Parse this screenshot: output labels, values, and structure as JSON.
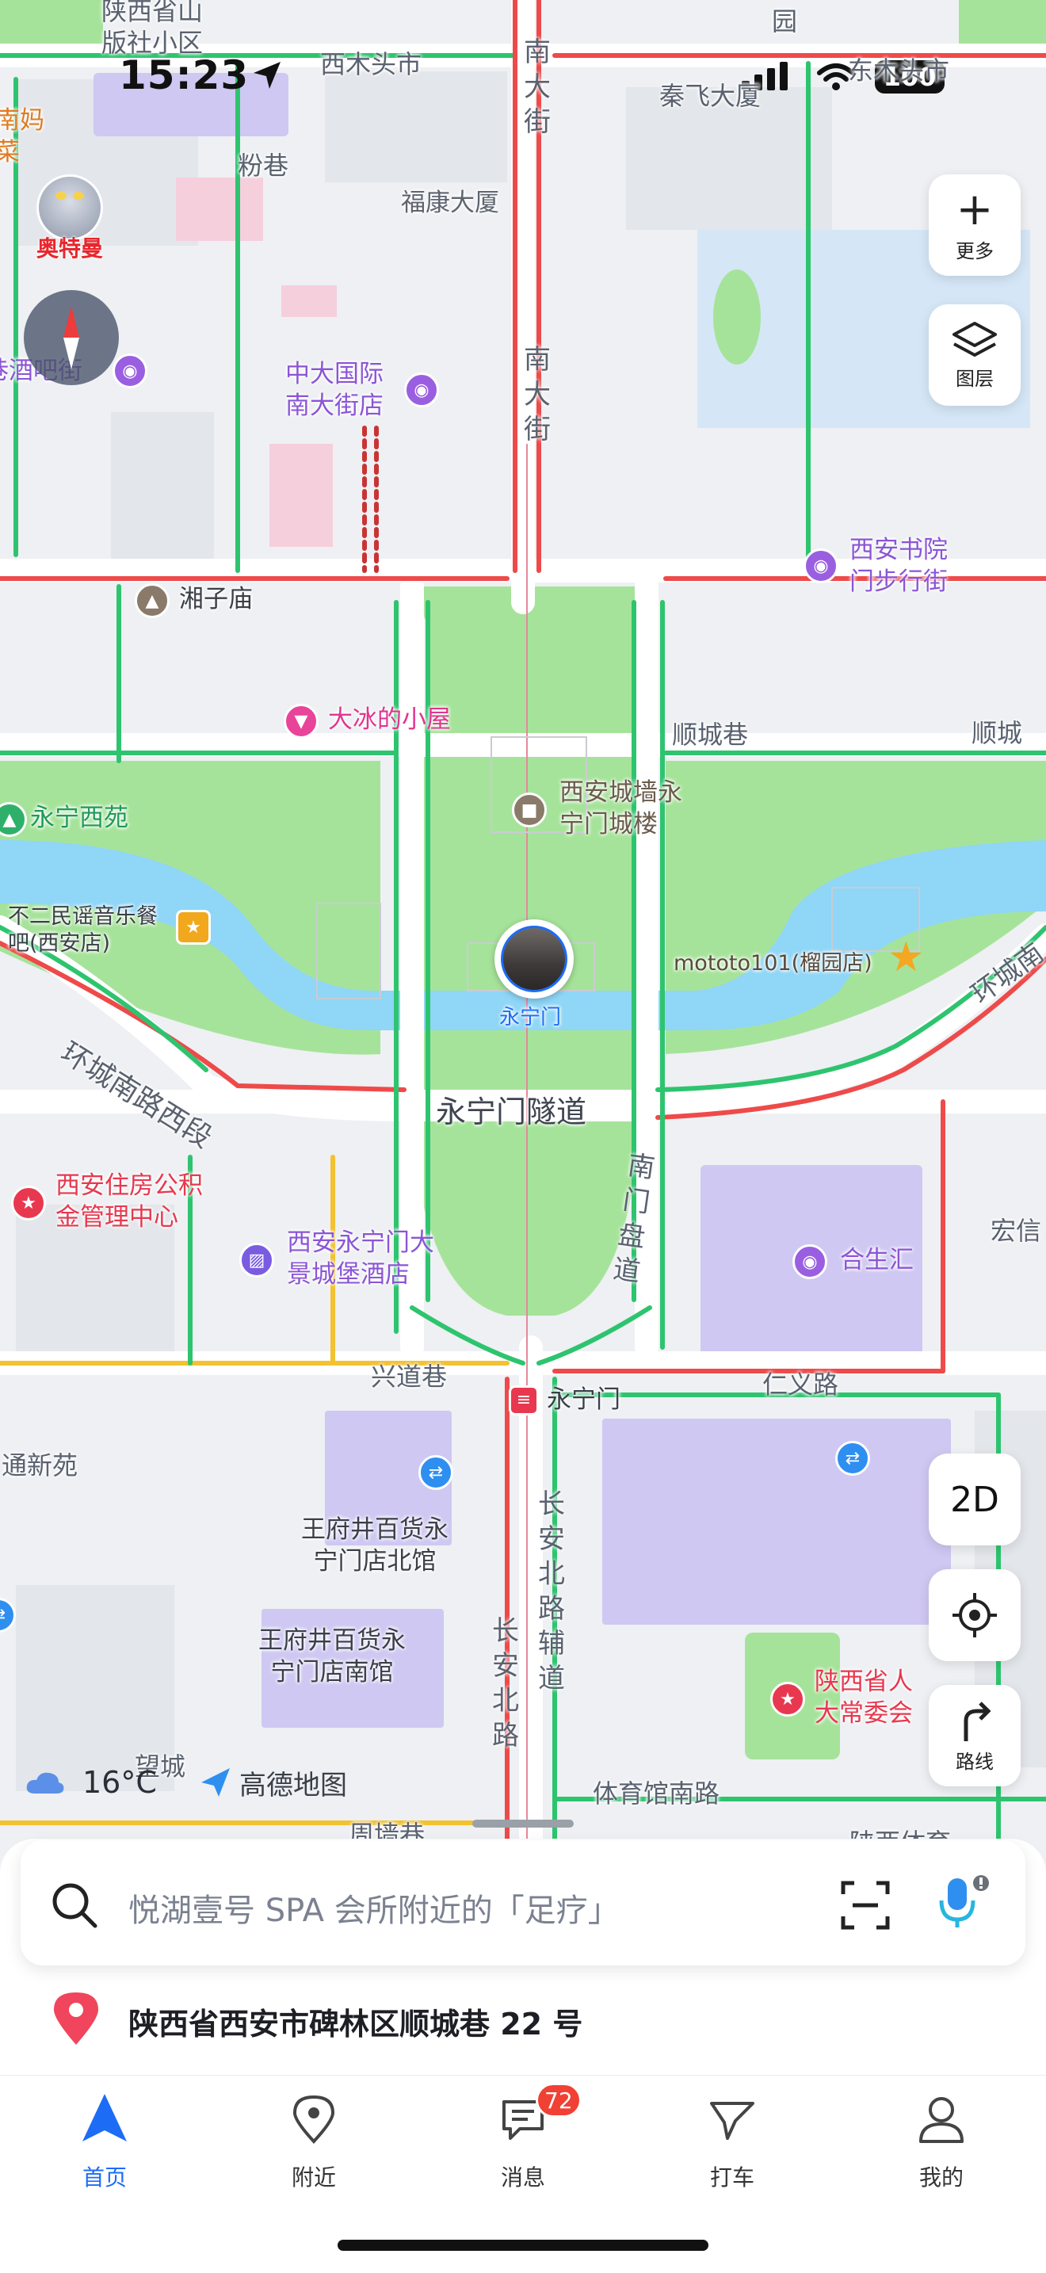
{
  "status_bar": {
    "time": "15:23",
    "battery": "100"
  },
  "map": {
    "road_labels": {
      "xi_mu_tou_shi": "西木头市",
      "fen_xiang": "粉巷",
      "nan_da_jie_1": "南大街",
      "nan_da_jie_2": "南大街",
      "qin_fei_da_xia": "秦飞大厦",
      "dong_mu_tou_shi": "东木头市",
      "shun_cheng_xiang": "顺城巷",
      "shun_cheng_right": "顺城",
      "huan_cheng_nan_lu_xi_duan": "环城南路西段",
      "yong_ning_men_sui_dao": "永宁门隧道",
      "nan_men_pan_dao": "南门盘道",
      "huan_cheng_right": "环城南",
      "xing_dao_xiang": "兴道巷",
      "ren_yi_lu": "仁义路",
      "chang_an_bei_lu_fu_dao": "长安北路辅道",
      "chang_an_bei_lu": "长安北路",
      "ti_yu_guan_nan_lu": "体育馆南路",
      "tong_xin_yuan": "通新苑",
      "wang_cheng": "望城",
      "zhou_qiang_xiang": "周墙巷",
      "hong_xin": "宏信",
      "top_left_partial": "陕西省山\n版社小区",
      "top_right_partial": "园",
      "left_partial": "南妈\n菜",
      "shaanxi_ti_yu": "陕西体育"
    },
    "pois": {
      "fu_kang_da_xia": "福康大厦",
      "zhong_da_guo_ji": "中大国际\n南大街店",
      "xiang_zi_miao": "湘子庙",
      "xi_an_shu_yuan": "西安书院\n门步行街",
      "da_bing_de_xiao_wu": "大冰的小屋",
      "xi_an_cheng_qiang": "西安城墙永\n宁门城楼",
      "yong_ning_xi_yuan": "永宁西苑",
      "bu_er_min_yao": "不二民谣音乐餐\n吧(西安店)",
      "yong_ning_men": "永宁门",
      "mototo": "mototo101(榴园店)",
      "zhu_fang_gong_ji_jin": "西安住房公积\n金管理中心",
      "yong_ning_men_hotel": "西安永宁门大\n景城堡酒店",
      "he_sheng_hui": "合生汇",
      "metro_yong_ning_men": "永宁门",
      "wang_fu_jing_bei": "王府井百货永\n宁门店北馆",
      "wang_fu_jing_nan": "王府井百货永\n宁门店南馆",
      "ren_da_chang_wei": "陕西省人\n大常委会",
      "xiang_jiu": "巷酒吧街",
      "ultraman_badge": "奥特曼"
    },
    "weather": {
      "temp": "16°C"
    },
    "brand": "高德地图"
  },
  "controls": {
    "more_label": "更多",
    "layers_label": "图层",
    "view_mode": "2D",
    "route_label": "路线"
  },
  "search": {
    "placeholder": "悦湖壹号 SPA 会所附近的「足疗」"
  },
  "location": {
    "address": "陕西省西安市碑林区顺城巷 22 号"
  },
  "tabs": [
    {
      "label": "首页"
    },
    {
      "label": "附近"
    },
    {
      "label": "消息",
      "badge": "72"
    },
    {
      "label": "打车"
    },
    {
      "label": "我的"
    }
  ],
  "colors": {
    "accent": "#1d6cf5",
    "park": "#a6e39a",
    "water": "#8fd6f7",
    "road_green": "#2ec46f",
    "road_red": "#ee4a4a",
    "road_yellow": "#f2c230"
  }
}
